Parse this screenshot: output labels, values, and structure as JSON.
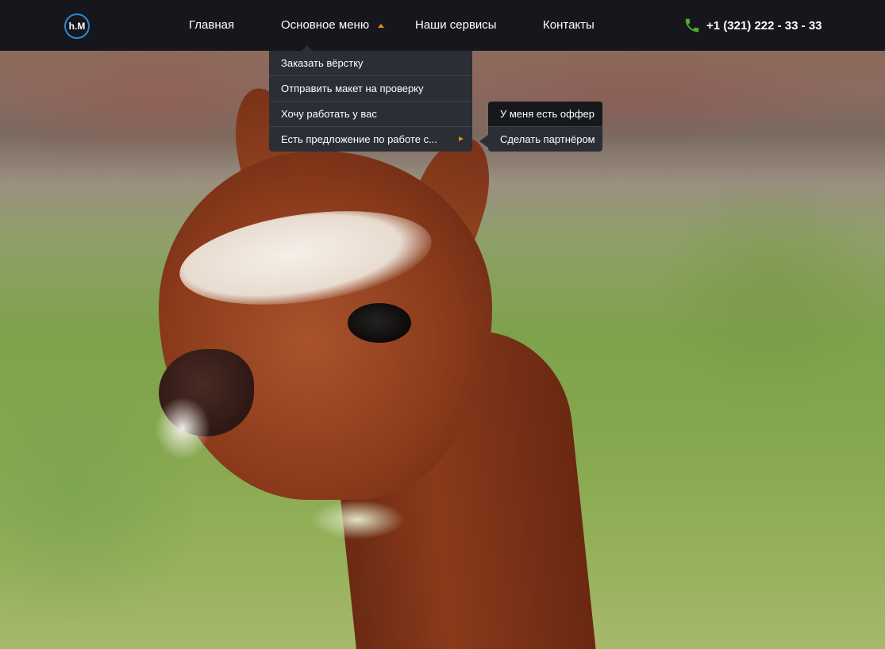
{
  "header": {
    "logo_text": "h.M",
    "nav": [
      {
        "label": "Главная"
      },
      {
        "label": "Основное меню"
      },
      {
        "label": "Наши сервисы"
      },
      {
        "label": "Контакты"
      }
    ],
    "phone": "+1 (321) 222 - 33 - 33",
    "phone_icon": "phone-icon",
    "accent_color": "#e38a22",
    "phone_icon_color": "#4caf2f"
  },
  "dropdown": {
    "items": [
      {
        "label": "Заказать вёрстку"
      },
      {
        "label": "Отправить макет на проверку"
      },
      {
        "label": "Хочу работать у вас"
      },
      {
        "label": "Есть предложение по работе с..."
      }
    ]
  },
  "submenu": {
    "items": [
      {
        "label": "У меня есть оффер"
      },
      {
        "label": "Сделать партнёром"
      }
    ]
  }
}
